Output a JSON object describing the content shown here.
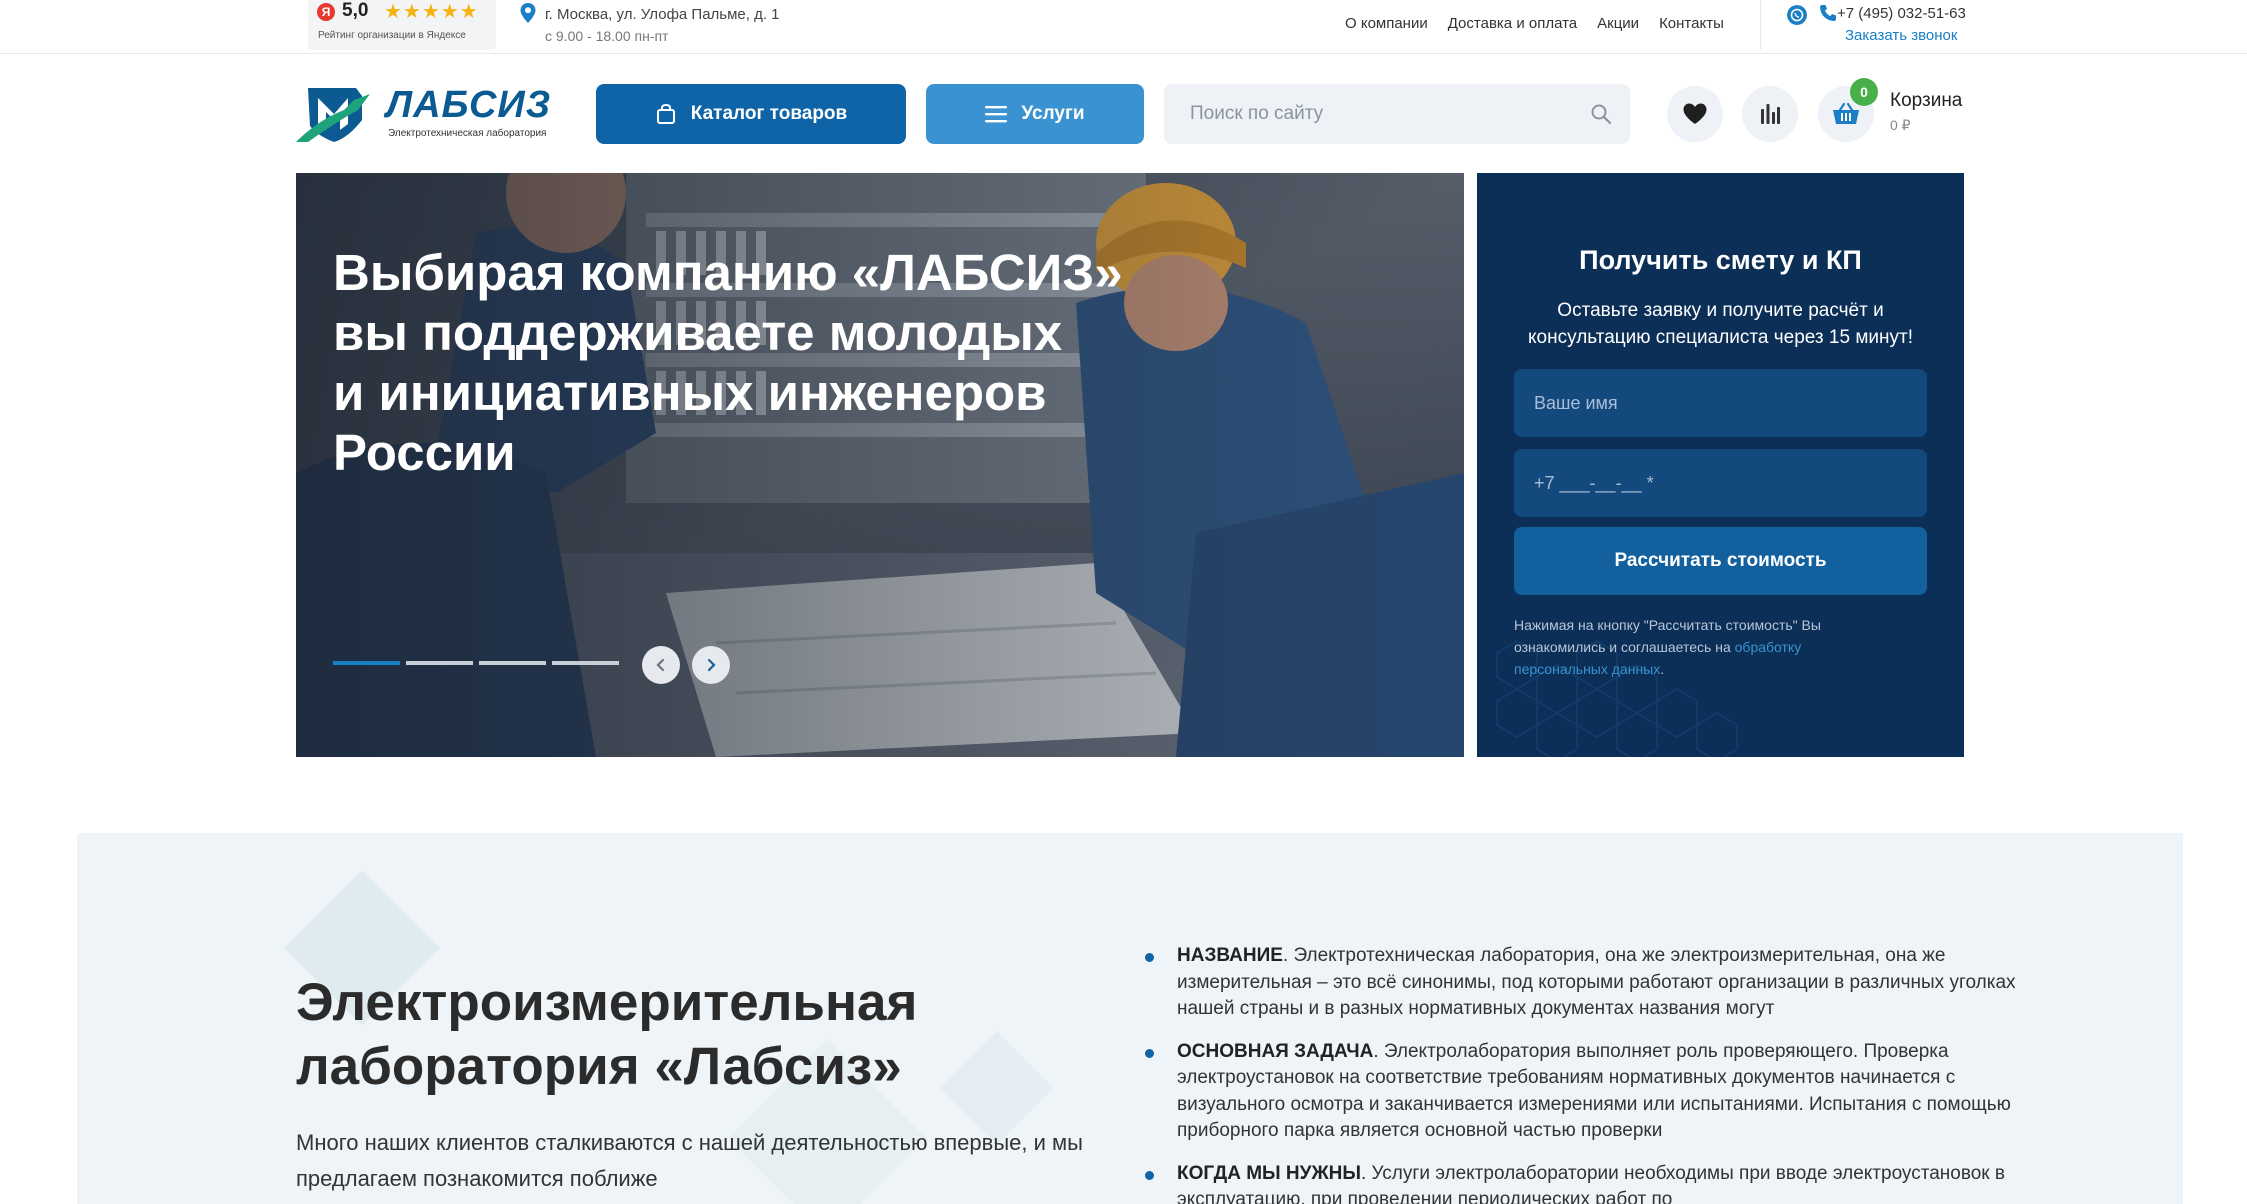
{
  "topbar": {
    "rating": {
      "logo": "Я",
      "value": "5,0",
      "stars": "★★★★★",
      "caption": "Рейтинг организации в Яндексе"
    },
    "address": "г. Москва, ул. Улофа Пальме, д. 1",
    "hours": "с 9.00 - 18.00 пн-пт",
    "nav": [
      "О компании",
      "Доставка и оплата",
      "Акции",
      "Контакты"
    ],
    "phone": "+7 (495) 032-51-63",
    "callback": "Заказать звонок"
  },
  "header": {
    "logo_text": "ЛАБСИЗ",
    "logo_sub": "Электротехническая лаборатория",
    "catalog_label": "Каталог товаров",
    "services_label": "Услуги",
    "search_placeholder": "Поиск по сайту",
    "cart_count": "0",
    "cart_label": "Корзина",
    "cart_sum": "0 ₽"
  },
  "hero": {
    "title_lines": [
      "Выбирая компанию «ЛАБСИЗ»",
      "вы поддерживаете молодых",
      "и инициативных инженеров",
      "России"
    ],
    "slides_total": 4,
    "active_slide": 1
  },
  "form": {
    "title": "Получить смету и КП",
    "description": "Оставьте заявку и получите расчёт и консультацию специалиста через 15 минут!",
    "name_placeholder": "Ваше имя",
    "phone_placeholder": "+7 ___-__-__ *",
    "submit_label": "Рассчитать стоимость",
    "note_prefix": "Нажимая на кнопку \"Рассчитать стоимость\" Вы ознакомились и соглашаетесь на ",
    "note_link": "обработку персональных данных",
    "note_suffix": "."
  },
  "about": {
    "title_line1": "Электроизмерительная",
    "title_line2": "лаборатория «Лабсиз»",
    "lead": "Много наших клиентов сталкиваются с нашей деятельностью впервые, и мы предлагаем познакомится поближе",
    "items": [
      {
        "term": "НАЗВАНИЕ",
        "text": ". Электротехническая лаборатория, она же электроизмерительная, она же измерительная – это всё синонимы, под которыми работают организации в различных уголках нашей страны и в разных нормативных документах названия могут"
      },
      {
        "term": "ОСНОВНАЯ ЗАДАЧА",
        "text": ". Электролаборатория выполняет роль проверяющего. Проверка электроустановок на соответствие требованиям нормативных документов начинается с визуального осмотра и заканчивается измерениями или испытаниями.  Испытания с помощью приборного парка является основной частью проверки"
      },
      {
        "term": "КОГДА МЫ НУЖНЫ",
        "text": ". Услуги электролаборатории необходимы при вводе электроустановок в эксплуатацию, при проведении периодических работ по"
      }
    ]
  }
}
